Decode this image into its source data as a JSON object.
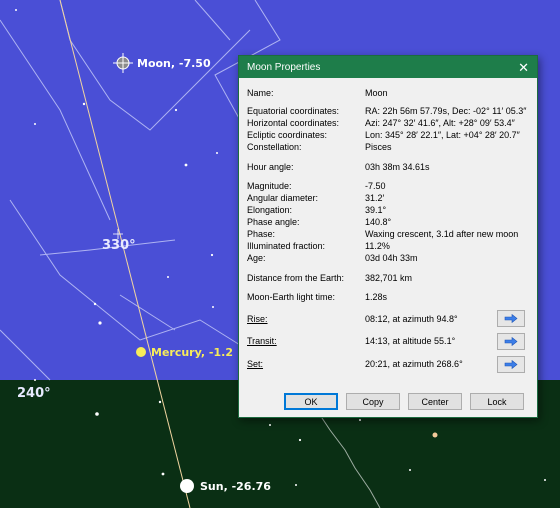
{
  "sky": {
    "moon_label": "Moon, -7.50",
    "mercury_label": "Mercury, -1.2",
    "sun_label": "Sun, -26.76",
    "label_330": "330°",
    "label_240": "240°",
    "sky_color": "#4a4fd6",
    "ground_color": "#0a2f14"
  },
  "dialog": {
    "title": "Moon Properties",
    "name_label": "Name:",
    "name_value": "Moon",
    "equatorial_label": "Equatorial coordinates:",
    "equatorial_value": "RA: 22h 56m 57.79s, Dec: -02° 11′ 05.3″",
    "horizontal_label": "Horizontal coordinates:",
    "horizontal_value": "Azi: 247° 32′ 41.6″, Alt: +28° 09′ 53.4″",
    "ecliptic_label": "Ecliptic coordinates:",
    "ecliptic_value": "Lon: 345° 28′ 22.1″, Lat: +04° 28′ 20.7″",
    "constellation_label": "Constellation:",
    "constellation_value": "Pisces",
    "hour_angle_label": "Hour angle:",
    "hour_angle_value": "03h 38m 34.61s",
    "magnitude_label": "Magnitude:",
    "magnitude_value": "-7.50",
    "angular_label": "Angular diameter:",
    "angular_value": "31.2′",
    "elongation_label": "Elongation:",
    "elongation_value": "39.1°",
    "phase_angle_label": "Phase angle:",
    "phase_angle_value": "140.8°",
    "phase_label": "Phase:",
    "phase_value": "Waxing crescent, 3.1d after new moon",
    "illuminated_label": "Illuminated fraction:",
    "illuminated_value": "11.2%",
    "age_label": "Age:",
    "age_value": "03d 04h 33m",
    "distance_label": "Distance from the Earth:",
    "distance_value": "382,701 km",
    "light_time_label": "Moon-Earth light time:",
    "light_time_value": "1.28s",
    "rise_label": "Rise:",
    "rise_value": "08:12, at azimuth 94.8°",
    "transit_label": "Transit:",
    "transit_value": "14:13, at altitude 55.1°",
    "set_label": "Set:",
    "set_value": "20:21, at azimuth 268.6°",
    "ok_label": "OK",
    "copy_label": "Copy",
    "center_label": "Center",
    "lock_label": "Lock"
  }
}
